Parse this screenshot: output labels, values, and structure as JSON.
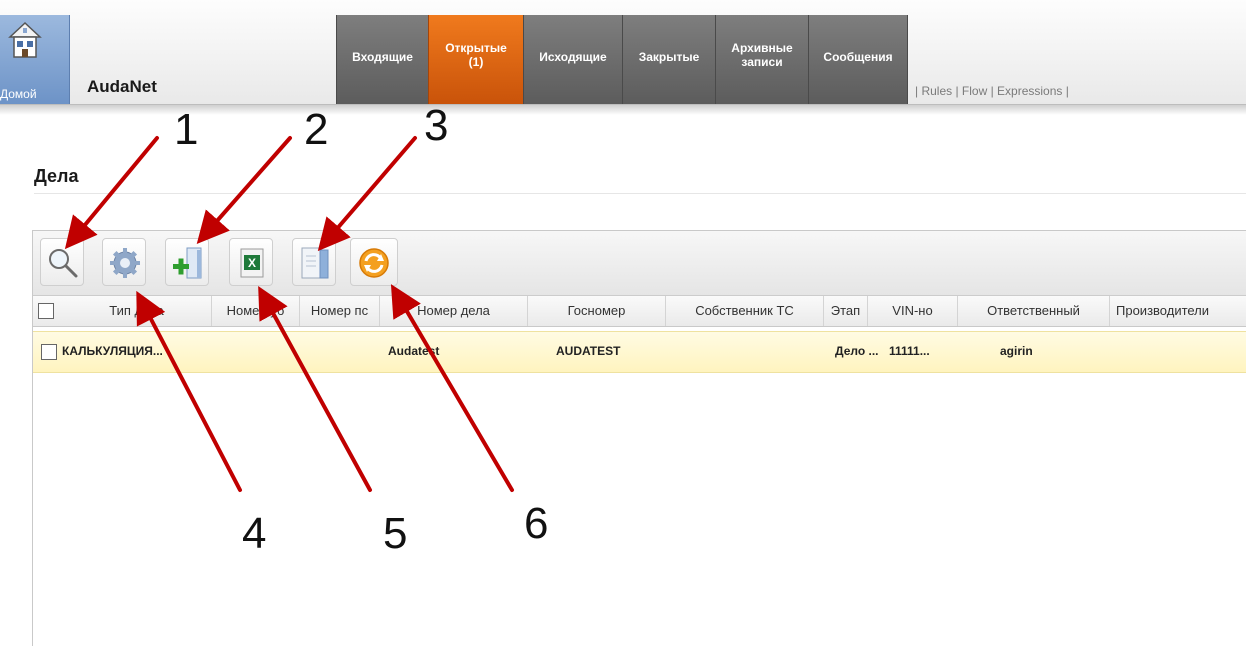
{
  "header": {
    "home_label": "Домой",
    "brand": "AudaNet",
    "tabs": [
      {
        "label": "Входящие"
      },
      {
        "label": "Открытые",
        "label2": "(1)",
        "active": true
      },
      {
        "label": "Исходящие"
      },
      {
        "label": "Закрытые"
      },
      {
        "label": "Архивные",
        "label2": "записи"
      },
      {
        "label": "Сообщения"
      }
    ],
    "links": "| Rules | Flow | Expressions |"
  },
  "page": {
    "title": "Дела"
  },
  "toolbar": {
    "buttons": [
      {
        "icon": "search-icon"
      },
      {
        "icon": "gear-icon"
      },
      {
        "icon": "add-document-icon"
      },
      {
        "icon": "excel-icon"
      },
      {
        "icon": "document-icon"
      },
      {
        "icon": "refresh-icon"
      }
    ]
  },
  "table": {
    "columns": [
      "Тип дела",
      "Номер уб",
      "Номер пс",
      "Номер дела",
      "Госномер",
      "Собственник ТС",
      "Этап",
      "VIN-но",
      "Ответственный",
      "Производители"
    ],
    "rows": [
      {
        "type": "КАЛЬКУЛЯЦИЯ...",
        "case_number": "Audatest",
        "plate": "AUDATEST",
        "stage": "Дело ...",
        "vin": "11111...",
        "responsible": "agirin"
      }
    ]
  },
  "annotations": [
    "1",
    "2",
    "3",
    "4",
    "5",
    "6"
  ],
  "colors": {
    "active_tab": "#e0680f",
    "tab": "#6e6e6e",
    "home": "#7a9dcf",
    "row_highlight": "#fff6c8",
    "arrow": "#c00000"
  }
}
